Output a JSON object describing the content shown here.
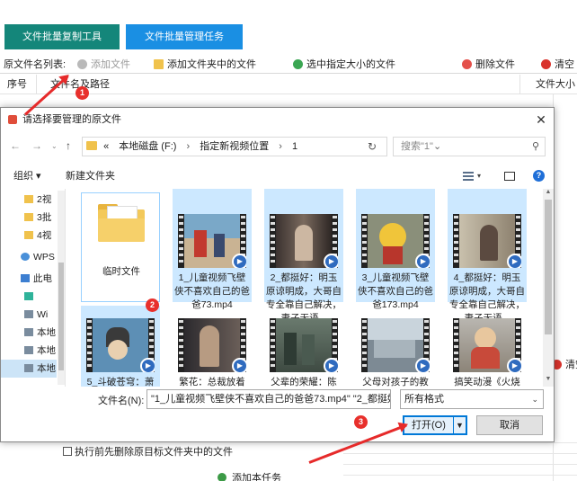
{
  "app": {
    "tabs": [
      "文件批量复制工具",
      "文件批量管理任务"
    ],
    "toolbar": {
      "list_label": "原文件名列表:",
      "add_file": "添加文件",
      "add_folder_files": "添加文件夹中的文件",
      "select_by_size": "选中指定大小的文件",
      "delete_file": "删除文件",
      "clear": "清空"
    },
    "columns": {
      "index": "序号",
      "path": "文件名及路径",
      "size": "文件大小"
    },
    "right_clear": "清空",
    "delete_source_option": "执行前先删除原目标文件夹中的文件",
    "add_task": "添加本任务"
  },
  "dialog": {
    "title": "请选择要管理的原文件",
    "address": {
      "overflow": "«",
      "drive": "本地磁盘 (F:)",
      "folder": "指定新视频位置",
      "sub": "1"
    },
    "search_placeholder": "搜索\"1\"",
    "organize": "组织 ▾",
    "new_folder": "新建文件夹",
    "nav_items": [
      "2视",
      "3批",
      "4视",
      "WPS",
      "此电",
      "",
      "Wi",
      "本地",
      "本地",
      "本地"
    ],
    "items": [
      {
        "name": "临时文件",
        "kind": "folder"
      },
      {
        "name": "1_儿童视频飞壁侠不喜欢自己的爸爸73.mp4",
        "kind": "video"
      },
      {
        "name": "2_都挺好：明玉原谅明成，大哥自专全靠自己解决，妻子无语...",
        "kind": "video"
      },
      {
        "name": "3_儿童视频飞壁侠不喜欢自己的爸爸173.mp4",
        "kind": "video"
      },
      {
        "name": "4_都挺好：明玉原谅明成，大哥自专全靠自己解决，妻子无语...",
        "kind": "video"
      },
      {
        "name": "5_斗破苍穹：萧",
        "kind": "video"
      },
      {
        "name": "繁花：总裁放着",
        "kind": "video"
      },
      {
        "name": "父辈的荣耀：陈",
        "kind": "video"
      },
      {
        "name": "父母对孩子的教",
        "kind": "video"
      },
      {
        "name": "搞笑动漫《火烧",
        "kind": "video"
      }
    ],
    "filename_label": "文件名(N):",
    "filename_value": "\"1_儿童视频飞壁侠不喜欢自己的爸爸73.mp4\" \"2_都挺好",
    "filter": "所有格式",
    "open": "打开(O)",
    "cancel": "取消"
  },
  "annotations": [
    "1",
    "2",
    "3"
  ],
  "colors": {
    "tab1": "#14867a",
    "tab2": "#1a8fe3",
    "select": "#cce8ff",
    "marker": "#e8302c"
  }
}
